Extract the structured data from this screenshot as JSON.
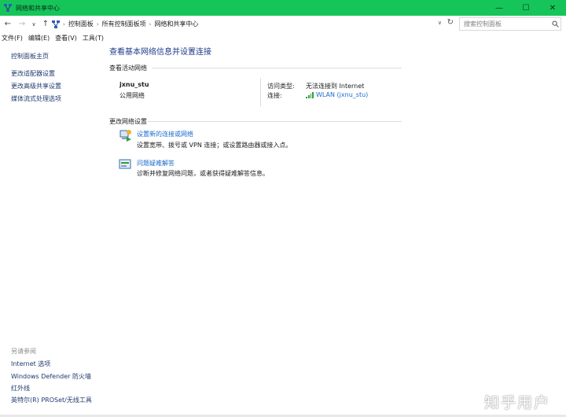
{
  "window": {
    "title": "网络和共享中心",
    "minimize": "—",
    "maximize": "☐",
    "close": "✕",
    "accent": "#16c55a"
  },
  "addressbar": {
    "back": "←",
    "forward": "→",
    "dropdown": "∨",
    "up": "↑",
    "breadcrumbs": [
      "控制面板",
      "所有控制面板项",
      "网络和共享中心"
    ],
    "separator": "›",
    "refresh": "↻",
    "search_placeholder": "搜索控制面板"
  },
  "menubar": {
    "items": [
      "文件(F)",
      "编辑(E)",
      "查看(V)",
      "工具(T)"
    ]
  },
  "leftpane": {
    "home": "控制面板主页",
    "links": [
      "更改适配器设置",
      "更改高级共享设置",
      "媒体流式处理选项"
    ],
    "see_also_label": "另请参阅",
    "see_also": [
      "Internet 选项",
      "Windows Defender 防火墙",
      "红外线",
      "英特尔(R) PROSet/无线工具"
    ]
  },
  "main": {
    "title": "查看基本网络信息并设置连接",
    "active_section": "查看活动网络",
    "network": {
      "name": "jxnu_stu",
      "type": "公用网络",
      "access_label": "访问类型:",
      "access_value": "无法连接到 Internet",
      "conn_label": "连接:",
      "conn_value": "WLAN (jxnu_stu)"
    },
    "change_section": "更改网络设置",
    "tasks": [
      {
        "link": "设置新的连接或网络",
        "desc": "设置宽带、拨号或 VPN 连接；或设置路由器或接入点。",
        "icon": "network-setup-icon"
      },
      {
        "link": "问题疑难解答",
        "desc": "诊断并修复网络问题，或者获得疑难解答信息。",
        "icon": "troubleshoot-icon"
      }
    ]
  },
  "watermark": "知乎用户"
}
